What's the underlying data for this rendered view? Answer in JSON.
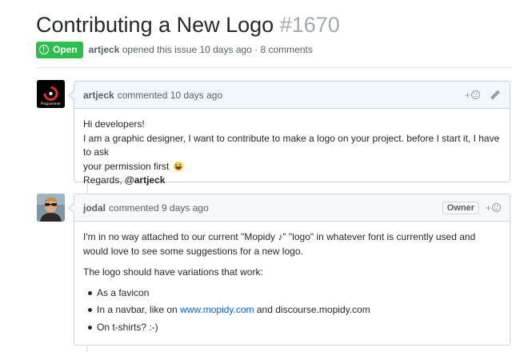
{
  "issue": {
    "title": "Contributing a New Logo",
    "number": "#1670",
    "state": "Open",
    "author": "artjeck",
    "meta": "opened this issue 10 days ago · 8 comments"
  },
  "comments": [
    {
      "author": "artjeck",
      "time": "commented 10 days ago",
      "reaction_label": "+",
      "avatar_text": "Programmer",
      "lines": [
        "Hi developers!",
        "I am a graphic designer, I want to contribute to make a logo on your project. before I start it, I have to ask",
        "your permission first",
        "Regards, "
      ],
      "mention": "@artjeck"
    },
    {
      "author": "jodal",
      "time": "commented 9 days ago",
      "owner_badge": "Owner",
      "reaction_label": "+",
      "paragraph1": "I'm in no way attached to our current \"Mopidy ♪\" \"logo\" in whatever font is currently used and would love to see some suggestions for a new logo.",
      "paragraph2": "The logo should have variations that work:",
      "items": {
        "favicon": "As a favicon",
        "navbar_prefix": "In a navbar, like on ",
        "navbar_link": "www.mopidy.com",
        "navbar_suffix": " and discourse.mopidy.com",
        "tshirts": "On t-shirts? :-)"
      }
    }
  ],
  "colors": {
    "open_badge": "#2cbe4e",
    "link": "#0366d6",
    "muted": "#586069"
  }
}
